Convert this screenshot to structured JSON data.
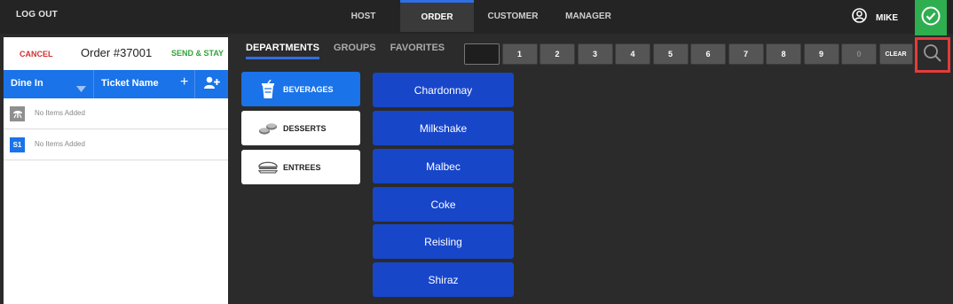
{
  "topbar": {
    "logout_label": "LOG OUT",
    "tabs": [
      {
        "label": "HOST",
        "active": false
      },
      {
        "label": "ORDER",
        "active": true
      },
      {
        "label": "CUSTOMER",
        "active": false
      },
      {
        "label": "MANAGER",
        "active": false
      }
    ],
    "user_name": "MIKE",
    "user_icon": "user-circle-icon",
    "confirm_icon": "check-circle-icon"
  },
  "order": {
    "cancel_label": "CANCEL",
    "title": "Order #37001",
    "send_stay_label": "SEND & STAY",
    "dine_label": "Dine In",
    "ticket_label": "Ticket Name",
    "plus_label": "+",
    "rows": [
      {
        "icon": "seat-icon",
        "text": "No Items Added"
      },
      {
        "icon": "S1",
        "text": "No Items Added"
      }
    ]
  },
  "menu": {
    "tabs": [
      {
        "label": "DEPARTMENTS",
        "active": true
      },
      {
        "label": "GROUPS",
        "active": false
      },
      {
        "label": "FAVORITES",
        "active": false
      }
    ],
    "numpad": [
      "1",
      "2",
      "3",
      "4",
      "5",
      "6",
      "7",
      "8",
      "9",
      "0"
    ],
    "clear_label": "CLEAR",
    "search_icon": "search-icon",
    "categories": [
      {
        "label": "BEVERAGES",
        "icon": "drink-icon",
        "active": true
      },
      {
        "label": "DESSERTS",
        "icon": "dessert-icon",
        "active": false
      },
      {
        "label": "ENTREES",
        "icon": "sandwich-icon",
        "active": false
      }
    ],
    "items": [
      "Chardonnay",
      "Milkshake",
      "Malbec",
      "Coke",
      "Reisling",
      "Shiraz"
    ]
  },
  "colors": {
    "accent_blue": "#1a73e8",
    "item_blue": "#1846c9",
    "confirm_green": "#2fae4f",
    "cancel_red": "#d23030",
    "send_green": "#33a33a",
    "highlight_red": "#e63b3b"
  }
}
